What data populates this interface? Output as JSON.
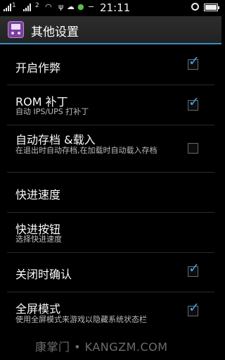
{
  "status_bar": {
    "carrier_1": "1",
    "carrier_2": "2",
    "time": "21:11"
  },
  "action_bar": {
    "title": "其他设置"
  },
  "settings": [
    {
      "title": "开启作弊",
      "subtitle": "",
      "checked": true
    },
    {
      "title": "ROM 补丁",
      "subtitle": "自动 IPS/UPS 打补丁",
      "checked": true
    },
    {
      "title": "自动存档 &载入",
      "subtitle": "在退出时自动存档,在加载时自动载入存档",
      "checked": false
    },
    {
      "title": "快进速度",
      "subtitle": "",
      "checked": null
    },
    {
      "title": "快进按钮",
      "subtitle": "选择快进速度",
      "checked": null
    },
    {
      "title": "关闭时确认",
      "subtitle": "",
      "checked": true
    },
    {
      "title": "全屏模式",
      "subtitle": "使用全屏模式来游戏以隐藏系统状态栏",
      "checked": true
    }
  ],
  "watermark": "康掌门 • KANGZM.COM",
  "colors": {
    "accent": "#3a8cc1",
    "check": "#39a9e8",
    "app_icon": "#7a3fa0"
  }
}
